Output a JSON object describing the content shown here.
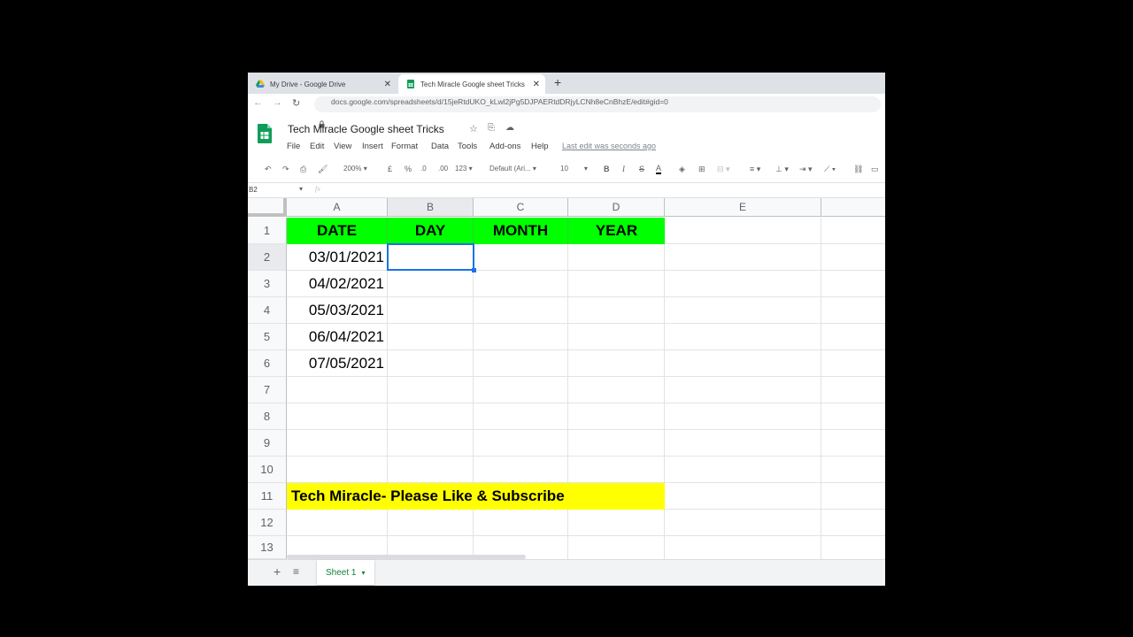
{
  "browser": {
    "tabs": [
      {
        "title": "My Drive - Google Drive",
        "close": "✕"
      },
      {
        "title": "Tech Miracle Google sheet Tricks",
        "close": "✕"
      }
    ],
    "new_tab": "+",
    "url": "docs.google.com/spreadsheets/d/15jeRtdUKO_kLwl2jPg5DJPAERtdDRjyLCNh8eCnBhzE/edit#gid=0"
  },
  "sheet": {
    "title": "Tech Miracle Google sheet Tricks",
    "menus": [
      "File",
      "Edit",
      "View",
      "Insert",
      "Format",
      "Data",
      "Tools",
      "Add-ons",
      "Help"
    ],
    "last_edit": "Last edit was seconds ago",
    "toolbar": {
      "zoom": "200%",
      "currency": "£",
      "percent": "%",
      "dec_less": ".0",
      "dec_more": ".00",
      "number_format": "123",
      "font": "Default (Ari...",
      "font_size": "10",
      "bold": "B",
      "italic": "I",
      "strike": "S",
      "text_color": "A"
    },
    "name_box": "B2",
    "fx": "fx",
    "columns": [
      "A",
      "B",
      "C",
      "D",
      "E"
    ],
    "rows": [
      "1",
      "2",
      "3",
      "4",
      "5",
      "6",
      "7",
      "8",
      "9",
      "10",
      "11",
      "12",
      "13"
    ],
    "header_row": [
      "DATE",
      "DAY",
      "MONTH",
      "YEAR"
    ],
    "dates": [
      "03/01/2021",
      "04/02/2021",
      "05/03/2021",
      "06/04/2021",
      "07/05/2021"
    ],
    "banner": "Tech Miracle- Please Like & Subscribe",
    "sheet_tab": "Sheet 1",
    "add_sheet": "+",
    "all_sheets": "≡",
    "colors": {
      "header_fill": "#00ff00",
      "banner_fill": "#ffff00",
      "selection": "#1a73e8",
      "sheets_green": "#188038"
    }
  }
}
